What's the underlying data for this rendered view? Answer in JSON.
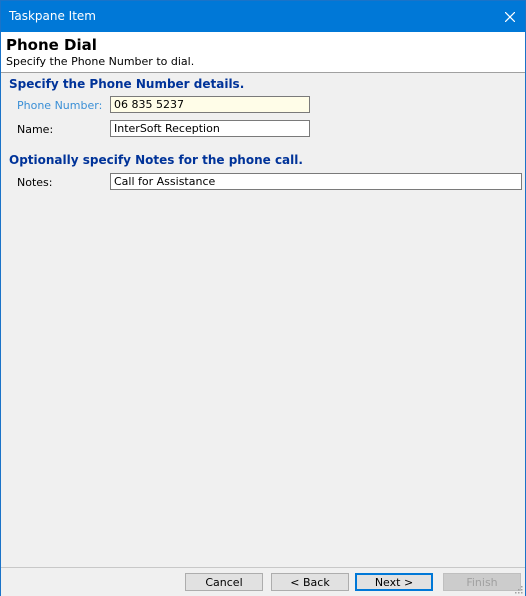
{
  "window": {
    "title": "Taskpane Item"
  },
  "header": {
    "title": "Phone Dial",
    "subtitle": "Specify the Phone Number to dial."
  },
  "sections": {
    "phone": {
      "title": "Specify the Phone Number details.",
      "phone_number_label": "Phone Number:",
      "phone_number_value": "06 835 5237",
      "name_label": "Name:",
      "name_value": "InterSoft Reception"
    },
    "notes": {
      "title": "Optionally specify Notes for the phone call.",
      "notes_label": "Notes:",
      "notes_value": "Call for Assistance"
    }
  },
  "footer": {
    "cancel_label": "Cancel",
    "back_label": "< Back",
    "next_label": "Next >",
    "finish_label": "Finish"
  },
  "colors": {
    "titlebar": "#0078d7",
    "section_title": "#003399",
    "active_label": "#3a8fd6",
    "focused_input_bg": "#fffde8"
  }
}
